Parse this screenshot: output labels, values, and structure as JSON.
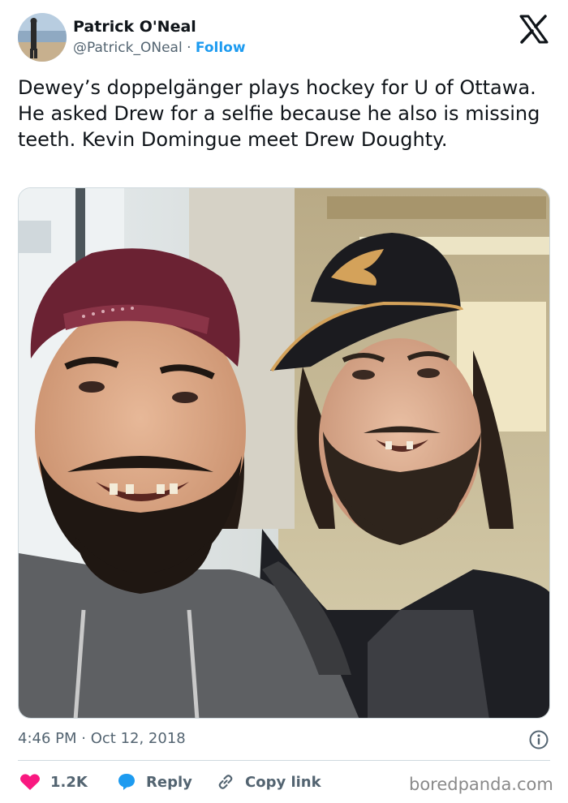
{
  "author": {
    "display_name": "Patrick O'Neal",
    "handle": "@Patrick_ONeal",
    "separator": "·",
    "follow_label": "Follow"
  },
  "platform_icon": "x-logo-icon",
  "tweet": {
    "text": "Dewey’s doppelgänger plays hockey for U of Ottawa. He asked Drew for a selfie because he also is missing teeth. Kevin Domingue meet Drew Doughty.",
    "time": "4:46 PM",
    "separator": "·",
    "date": "Oct 12, 2018"
  },
  "actions": {
    "like_count": "1.2K",
    "reply_label": "Reply",
    "copy_link_label": "Copy link"
  },
  "icons": [
    "heart-icon",
    "reply-bubble-icon",
    "link-icon",
    "info-icon"
  ],
  "watermark": "boredpanda.com",
  "colors": {
    "accent": "#1d9bf0",
    "heart": "#f91880",
    "text": "#0f1419",
    "secondary": "#536471"
  }
}
